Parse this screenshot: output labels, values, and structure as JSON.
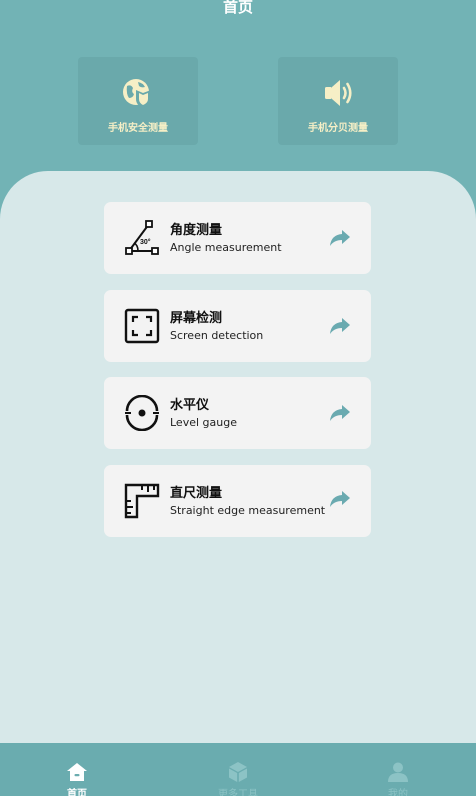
{
  "header": {
    "title": "首页"
  },
  "quick_tiles": [
    {
      "label": "手机安全测量",
      "icon": "shield-globe-icon"
    },
    {
      "label": "手机分贝测量",
      "icon": "speaker-icon"
    }
  ],
  "tools": [
    {
      "title": "角度测量",
      "subtitle": "Angle measurement",
      "icon": "angle-icon",
      "angle_text": "30°"
    },
    {
      "title": "屏幕检测",
      "subtitle": "Screen detection",
      "icon": "screen-frame-icon"
    },
    {
      "title": "水平仪",
      "subtitle": "Level gauge",
      "icon": "level-icon"
    },
    {
      "title": "直尺测量",
      "subtitle": "Straight edge measurement",
      "icon": "ruler-icon"
    }
  ],
  "tabs": [
    {
      "label": "首页",
      "icon": "home-icon",
      "active": true
    },
    {
      "label": "更多工具",
      "icon": "cube-icon",
      "active": false
    },
    {
      "label": "我的",
      "icon": "user-icon",
      "active": false
    }
  ],
  "colors": {
    "header_bg": "#72B3B5",
    "panel_bg": "#D7E8E9",
    "tile_label": "#F6EFC6",
    "arrow": "#6AAAB0"
  }
}
